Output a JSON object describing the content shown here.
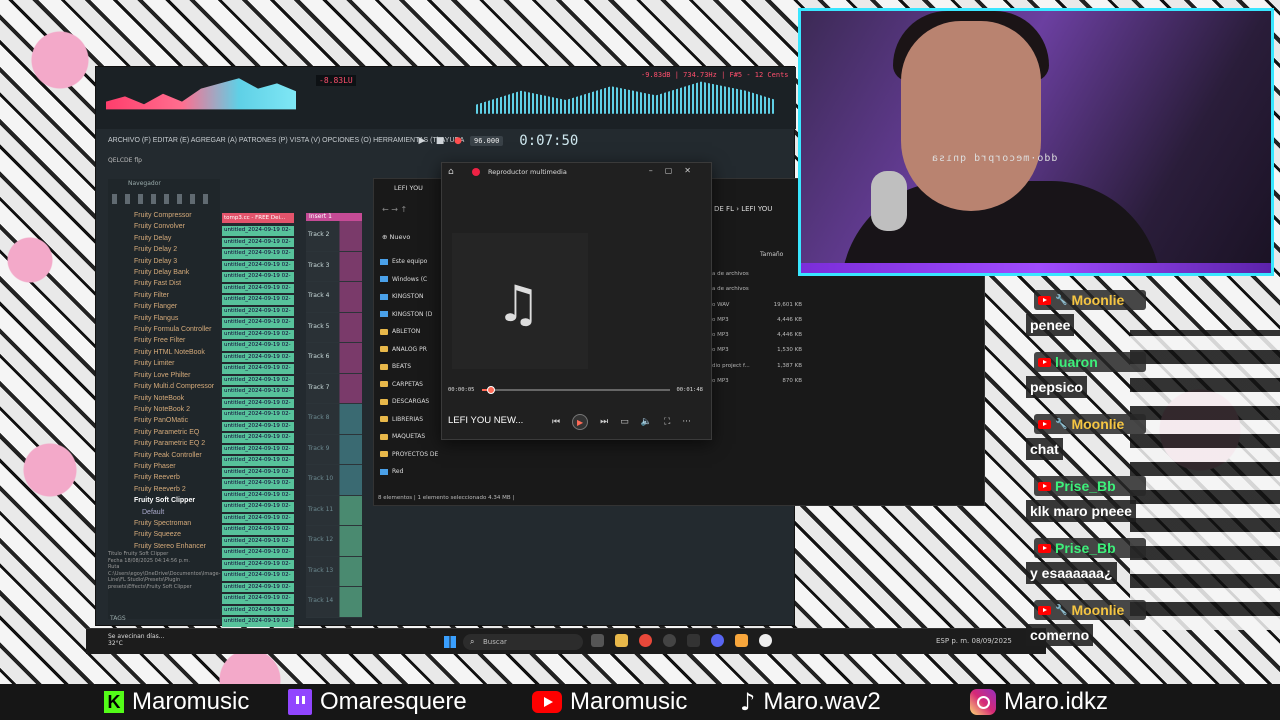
{
  "fl": {
    "lufs": "-8.83LU",
    "pitch_readout": "-9.83dB | 734.73Hz | F#5 - 12 Cents",
    "menu": "ARCHIVO (F) EDITAR (E) AGREGAR (A) PATRONES (P) VISTA (V) OPCIONES (O) HERRAMIENTAS (T) AYUDA",
    "tempo": "96.000",
    "timer": "0:07:50",
    "plugin_selector": "QELCDE flp",
    "browser_title": "Navegador",
    "plugins": [
      "Fruity Compressor",
      "Fruity Convolver",
      "Fruity Delay",
      "Fruity Delay 2",
      "Fruity Delay 3",
      "Fruity Delay Bank",
      "Fruity Fast Dist",
      "Fruity Filter",
      "Fruity Flanger",
      "Fruity Flangus",
      "Fruity Formula Controller",
      "Fruity Free Filter",
      "Fruity HTML NoteBook",
      "Fruity Limiter",
      "Fruity Love Philter",
      "Fruity Multi.d Compressor",
      "Fruity NoteBook",
      "Fruity NoteBook 2",
      "Fruity PanOMatic",
      "Fruity Parametric EQ",
      "Fruity Parametric EQ 2",
      "Fruity Peak Controller",
      "Fruity Phaser",
      "Fruity Reeverb",
      "Fruity Reeverb 2",
      "Fruity Soft Clipper",
      "Default",
      "Fruity Spectroman",
      "Fruity Squeeze",
      "Fruity Stereo Enhancer"
    ],
    "selected_plugin": "Fruity Soft Clipper",
    "info": {
      "title_label": "Titulo",
      "title": "Fruity Soft Clipper",
      "date_label": "Fecha",
      "date": "18/08/2025 04:14:56 p.m.",
      "path_label": "Ruta",
      "path": "C:\\Users\\egoy\\OneDrive\\Documentos\\Image-Line\\FL Studio\\Presets\\Plugin presets\\Effects\\Fruity Soft Clipper"
    },
    "tags": "TAGS",
    "first_pattern": "tomp3.cc - FREE Dei...",
    "pattern_label": "untitled_2024-09-19 02-",
    "pattern_count": 36,
    "insert": "Insert 1",
    "tracks": [
      "Track 2",
      "Track 3",
      "Track 4",
      "Track 5",
      "Track 6",
      "Track 7",
      "Track 8",
      "Track 9",
      "Track 10",
      "Track 11",
      "Track 12",
      "Track 13",
      "Track 14"
    ]
  },
  "explorer": {
    "tab_title": "LEFI YOU",
    "new_label": "Nuevo",
    "path_label": "DE FL  ›  LEFI YOU",
    "size_header": "Tamaño",
    "tree": [
      {
        "label": "Este equipo",
        "type": "pc"
      },
      {
        "label": "Windows (C",
        "type": "drive"
      },
      {
        "label": "KINGSTON",
        "type": "drive"
      },
      {
        "label": "KINGSTON (D",
        "type": "drive"
      },
      {
        "label": "ABLETON",
        "type": "folder"
      },
      {
        "label": "ANALOG PR",
        "type": "folder"
      },
      {
        "label": "BEATS",
        "type": "folder"
      },
      {
        "label": "CARPETAS",
        "type": "folder"
      },
      {
        "label": "DESCARGAS",
        "type": "folder"
      },
      {
        "label": "LIBRERIAS",
        "type": "folder"
      },
      {
        "label": "MAQUETAS",
        "type": "folder"
      },
      {
        "label": "PROYECTOS DE",
        "type": "folder"
      },
      {
        "label": "Red",
        "type": "pc"
      }
    ],
    "files": [
      {
        "type": "a de archivos",
        "size": ""
      },
      {
        "type": "a de archivos",
        "size": ""
      },
      {
        "type": "o WAV",
        "size": "19,601 KB"
      },
      {
        "type": "o MP3",
        "size": "4,446 KB"
      },
      {
        "type": "o MP3",
        "size": "4,446 KB"
      },
      {
        "type": "o MP3",
        "size": "1,530 KB"
      },
      {
        "type": "dio project f...",
        "size": "1,387 KB"
      },
      {
        "type": "o MP3",
        "size": "870 KB"
      }
    ],
    "status": "8 elementos  |  1 elemento seleccionado  4.34 MB  |"
  },
  "player": {
    "title": "Reproductor multimedia",
    "current_time": "00:00:05",
    "total_time": "00:01:48",
    "progress": 0.05,
    "song": "LEFI YOU NEW...",
    "icons": [
      "previous-icon",
      "play-icon",
      "next-icon",
      "miniplayer-icon",
      "volume-icon",
      "fullscreen-icon",
      "more-icon"
    ]
  },
  "taskbar": {
    "weather_title": "Se avecinan días...",
    "weather_temp": "32°C",
    "search_placeholder": "Buscar",
    "tray_lang": "ESP",
    "time": "p. m.",
    "date": "08/09/2025"
  },
  "cam": {
    "mirrored_text": "ddo·mecorprd qnısa"
  },
  "chat": [
    {
      "user": "Moonlie",
      "color": "#f5c542",
      "mod": true,
      "text": "penee"
    },
    {
      "user": "luaron",
      "color": "#3df07a",
      "mod": false,
      "text": "pepsico"
    },
    {
      "user": "Moonlie",
      "color": "#f5c542",
      "mod": true,
      "text": "chat"
    },
    {
      "user": "Prise_Bb",
      "color": "#3df07a",
      "mod": false,
      "text": "klk maro pneee"
    },
    {
      "user": "Prise_Bb",
      "color": "#3df07a",
      "mod": false,
      "text": "y esaaaaaa¿"
    },
    {
      "user": "Moonlie",
      "color": "#f5c542",
      "mod": true,
      "text": "comerno"
    }
  ],
  "social": [
    {
      "icon": "kick-icon",
      "label": "Maromusic",
      "color": "#53fc18"
    },
    {
      "icon": "twitch-icon",
      "label": "Omaresquere",
      "color": "#9146ff"
    },
    {
      "icon": "youtube-icon",
      "label": "Maromusic",
      "color": "#ff0000"
    },
    {
      "icon": "tiktok-icon",
      "label": "Maro.wav2",
      "color": "#ffffff"
    },
    {
      "icon": "instagram-icon",
      "label": "Maro.idkz",
      "color": "#d62976"
    }
  ]
}
